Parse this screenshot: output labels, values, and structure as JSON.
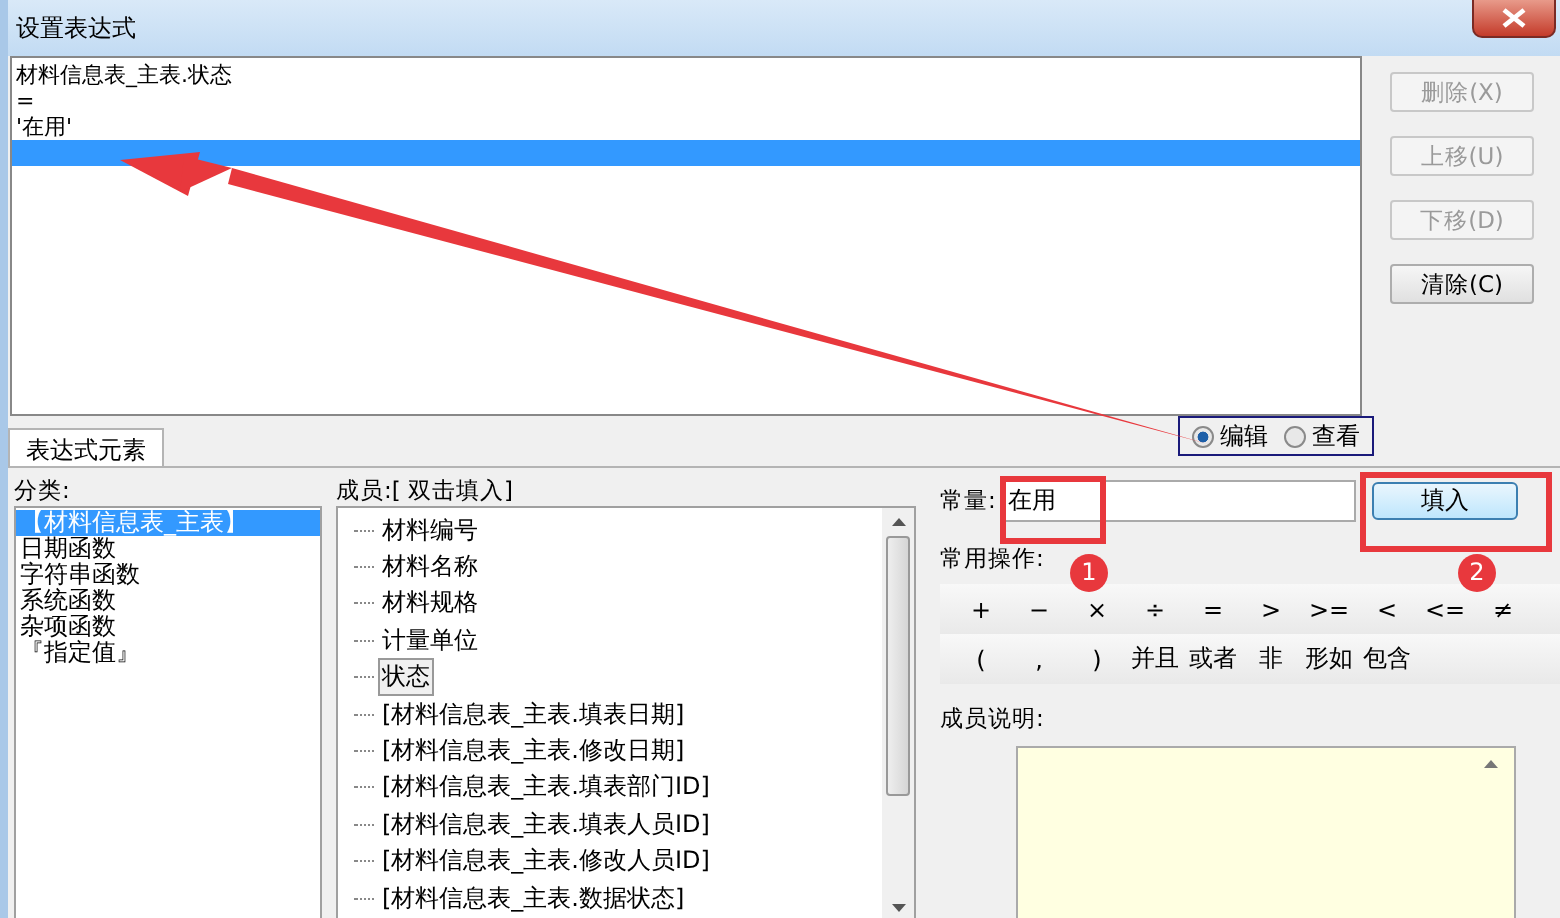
{
  "window": {
    "title": "设置表达式"
  },
  "expression_lines": [
    {
      "text": "材料信息表_主表.状态",
      "selected": false
    },
    {
      "text": "=",
      "selected": false
    },
    {
      "text": "'在用'",
      "selected": false
    },
    {
      "selected": true
    }
  ],
  "side_buttons": [
    {
      "label": "删除(X)",
      "disabled": true
    },
    {
      "label": "上移(U)",
      "disabled": true
    },
    {
      "label": "下移(D)",
      "disabled": true
    },
    {
      "label": "清除(C)",
      "disabled": false
    }
  ],
  "view_mode": [
    {
      "label": "编辑",
      "selected": true
    },
    {
      "label": "查看",
      "selected": false
    }
  ],
  "tabs": [
    {
      "label": "表达式元素",
      "selected": true
    }
  ],
  "categories": {
    "label": "分类:",
    "items": [
      {
        "text": "【材料信息表_主表】",
        "selected": true
      },
      {
        "text": "日期函数",
        "selected": false
      },
      {
        "text": "字符串函数",
        "selected": false
      },
      {
        "text": "系统函数",
        "selected": false
      },
      {
        "text": "杂项函数",
        "selected": false
      },
      {
        "text": "『指定值』",
        "selected": false
      }
    ]
  },
  "members": {
    "label": "成员:[ 双击填入]",
    "items": [
      {
        "text": "材料编号",
        "selected": false
      },
      {
        "text": "材料名称",
        "selected": false
      },
      {
        "text": "材料规格",
        "selected": false
      },
      {
        "text": "计量单位",
        "selected": false
      },
      {
        "text": "状态",
        "selected": true
      },
      {
        "text": "[材料信息表_主表.填表日期]",
        "selected": false
      },
      {
        "text": "[材料信息表_主表.修改日期]",
        "selected": false
      },
      {
        "text": "[材料信息表_主表.填表部门ID]",
        "selected": false
      },
      {
        "text": "[材料信息表_主表.填表人员ID]",
        "selected": false
      },
      {
        "text": "[材料信息表_主表.修改人员ID]",
        "selected": false
      },
      {
        "text": "[材料信息表_主表.数据状态]",
        "selected": false
      }
    ]
  },
  "constant": {
    "label": "常量:",
    "value": "在用",
    "button": "填入"
  },
  "operations": {
    "label": "常用操作:",
    "rows": [
      [
        "+",
        "−",
        "×",
        "÷",
        "=",
        ">",
        ">=",
        "<",
        "<=",
        "≠"
      ],
      [
        "(",
        ",",
        ")",
        "并且",
        "或者",
        "非",
        "形如",
        "包含"
      ]
    ]
  },
  "member_description": {
    "label": "成员说明:"
  },
  "annotation_markers": [
    {
      "number": "1"
    },
    {
      "number": "2"
    }
  ]
}
